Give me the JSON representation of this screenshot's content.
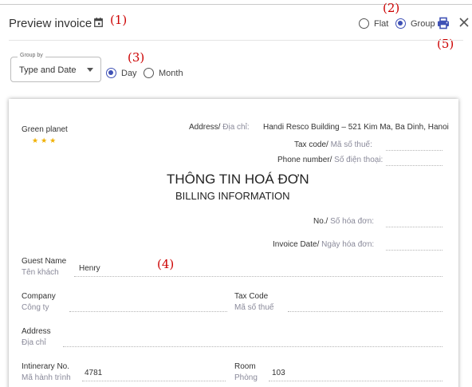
{
  "header": {
    "title": "Preview invoice",
    "view_options": {
      "flat_label": "Flat",
      "group_label": "Group",
      "selected": "Group"
    }
  },
  "annotations": [
    "(1)",
    "(2)",
    "(3)",
    "(4)",
    "(5)"
  ],
  "controls": {
    "group_by": {
      "legend": "Group by",
      "value": "Type and Date"
    },
    "period": {
      "day_label": "Day",
      "month_label": "Month",
      "selected": "Day"
    }
  },
  "invoice": {
    "hotel_name": "Green planet",
    "address_label": "Address/",
    "address_label_vn": "Địa chỉ:",
    "address_value": "Handi Resco Building – 521 Kim Ma, Ba Dinh, Hanoi",
    "taxcode_label": "Tax code/",
    "taxcode_label_vn": "Mã số thuế:",
    "phone_label": "Phone number/",
    "phone_label_vn": "Số điện thoại:",
    "title_vn": "THÔNG TIN HOÁ ĐƠN",
    "title_en": "BILLING INFORMATION",
    "no_label": "No./",
    "no_label_vn": "Số hóa đơn:",
    "date_label": "Invoice Date/",
    "date_label_vn": "Ngày hóa đơn:",
    "guest_label": "Guest Name",
    "guest_label_vn": "Tên khách",
    "guest_value": "Henry",
    "company_label": "Company",
    "company_label_vn": "Công ty",
    "company_taxcode_label": "Tax Code",
    "company_taxcode_label_vn": "Mã số thuế",
    "addr2_label": "Address",
    "addr2_label_vn": "Địa chỉ",
    "itinerary_label": "Intinerary No.",
    "itinerary_label_vn": "Mã hành trình",
    "itinerary_value": "4781",
    "room_label": "Room",
    "room_label_vn": "Phòng",
    "room_value": "103"
  },
  "icons": {
    "calendar": "calendar-icon",
    "print": "print-icon",
    "close": "close-icon",
    "stars": "star-rating-icon"
  },
  "colors": {
    "accent": "#3f51b5",
    "annotation": "#cc0000",
    "star": "#f0b000"
  }
}
